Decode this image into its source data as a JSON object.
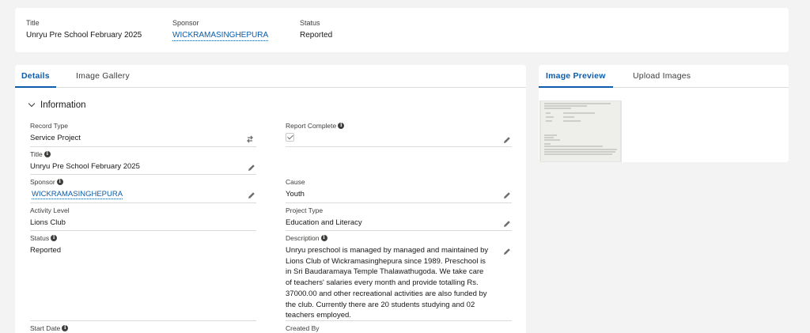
{
  "highlights": {
    "title_label": "Title",
    "title_value": "Unryu Pre School February 2025",
    "sponsor_label": "Sponsor",
    "sponsor_value": "WICKRAMASINGHEPURA",
    "status_label": "Status",
    "status_value": "Reported"
  },
  "left_tabs": [
    {
      "label": "Details",
      "active": true
    },
    {
      "label": "Image Gallery",
      "active": false
    }
  ],
  "right_tabs": [
    {
      "label": "Image Preview",
      "active": true
    },
    {
      "label": "Upload Images",
      "active": false
    }
  ],
  "section": {
    "title": "Information"
  },
  "fields": {
    "record_type": {
      "label": "Record Type",
      "value": "Service Project"
    },
    "report_complete": {
      "label": "Report Complete",
      "checked": true
    },
    "title": {
      "label": "Title",
      "value": "Unryu Pre School February 2025"
    },
    "sponsor": {
      "label": "Sponsor",
      "value": "WICKRAMASINGHEPURA"
    },
    "cause": {
      "label": "Cause",
      "value": "Youth"
    },
    "activity_level": {
      "label": "Activity Level",
      "value": "Lions Club"
    },
    "project_type": {
      "label": "Project Type",
      "value": "Education and Literacy"
    },
    "status": {
      "label": "Status",
      "value": "Reported"
    },
    "description": {
      "label": "Description",
      "value": "Unryu preschool is managed by managed and maintained by Lions Club of Wickramasinghepura since 1989. Preschool is in Sri Baudaramaya Temple Thalawathugoda. We take care of teachers' salaries every month and provide totalling Rs. 37000.00 and other recreational activities are also funded by the club. Currently there are 20 students studying and 02 teachers employed."
    },
    "start_date": {
      "label": "Start Date"
    },
    "created_by": {
      "label": "Created By"
    }
  },
  "icons": {
    "info": "info-icon",
    "edit": "pencil-icon",
    "change": "swap-icon",
    "chevron": "chevron-down-icon"
  },
  "colors": {
    "accent": "#0b5cab",
    "background": "#f3f3f3",
    "card": "#ffffff",
    "divider": "#dddbda"
  }
}
